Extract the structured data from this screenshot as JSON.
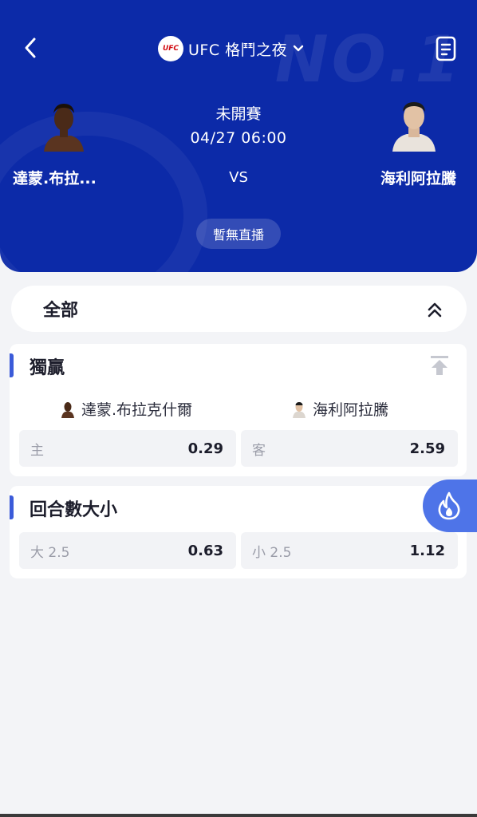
{
  "header": {
    "title": "UFC 格鬥之夜",
    "logo_text": "UFC",
    "watermark": "NO.1",
    "status": "未開賽",
    "datetime": "04/27  06:00",
    "vs": "VS",
    "live_label": "暫無直播",
    "fighter_left": {
      "name": "達蒙.布拉..."
    },
    "fighter_right": {
      "name": "海利阿拉騰"
    }
  },
  "filter": {
    "label": "全部"
  },
  "markets": [
    {
      "title": "獨贏",
      "picks": [
        {
          "name": "達蒙.布拉克什爾"
        },
        {
          "name": "海利阿拉騰"
        }
      ],
      "odds": [
        {
          "label": "主",
          "value": "0.29"
        },
        {
          "label": "客",
          "value": "2.59"
        }
      ]
    },
    {
      "title": "回合數大小",
      "odds": [
        {
          "label": "大 2.5",
          "value": "0.63"
        },
        {
          "label": "小 2.5",
          "value": "1.12"
        }
      ]
    }
  ],
  "colors": {
    "header_bg": "#0c2aa8",
    "accent": "#3b5bd9",
    "hot_button": "#4e74e8",
    "page_bg": "#f3f4f7"
  },
  "icons": {
    "back": "chevron-left-icon",
    "dropdown": "chevron-down-icon",
    "document": "document-icon",
    "collapse": "double-chevron-up-icon",
    "pin": "pin-to-top-icon",
    "hot": "flame-icon"
  }
}
